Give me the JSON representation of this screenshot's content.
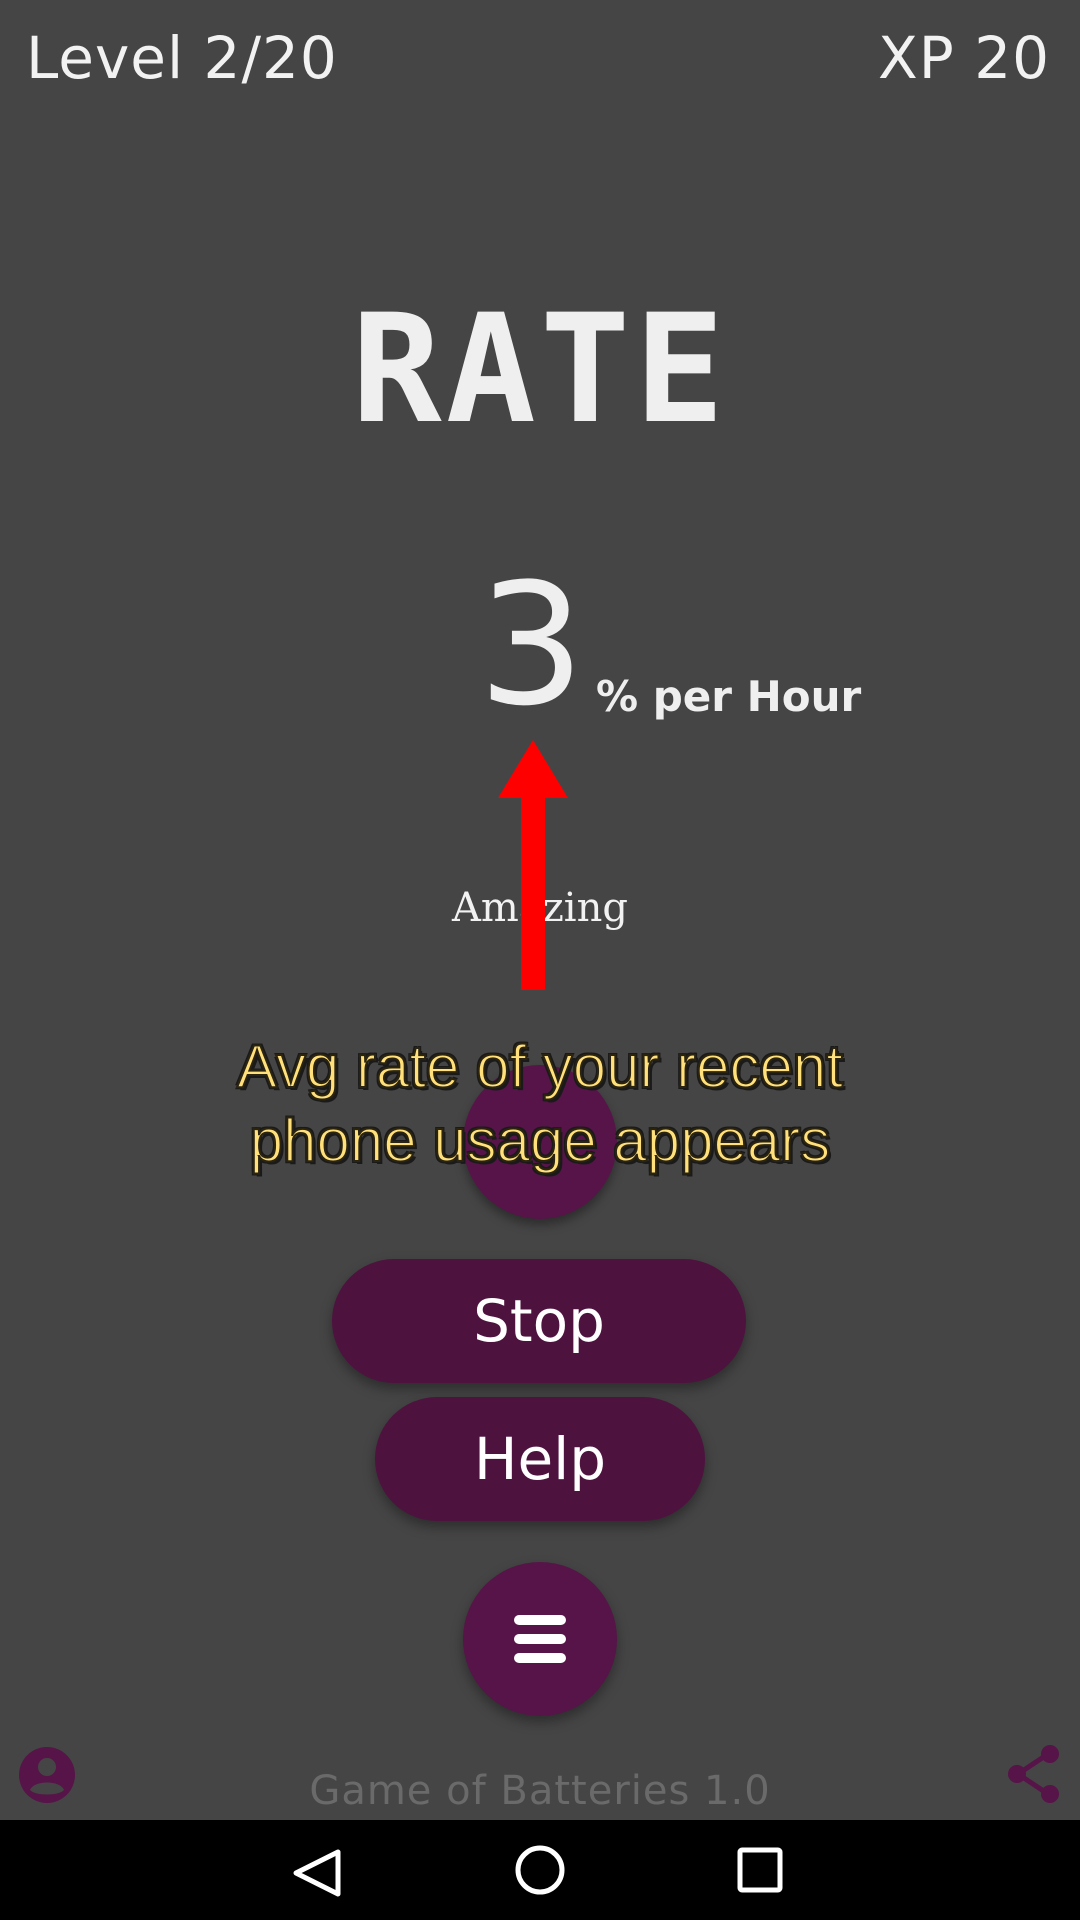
{
  "header": {
    "level": "Level 2/20",
    "xp": "XP 20"
  },
  "main": {
    "title": "RATE",
    "rate_value": "3",
    "rate_unit": "% per Hour",
    "status": "Amazing"
  },
  "annotation": {
    "line1": "Avg rate of your recent",
    "line2": "phone usage appears"
  },
  "buttons": {
    "stop": "Stop",
    "help": "Help"
  },
  "footer": {
    "version": "Game of Batteries 1.0"
  },
  "icons": {
    "menu": "hamburger-menu-icon",
    "account": "account-circle-icon",
    "share": "share-icon",
    "arrow": "red-up-arrow-icon",
    "nav_back": "back-triangle-icon",
    "nav_home": "home-circle-icon",
    "nav_recent": "recent-square-icon"
  },
  "colors": {
    "background": "#454545",
    "button": "#4e123f",
    "accent": "#561448",
    "annotation_text": "#ffe07a",
    "arrow": "#ff0000"
  }
}
